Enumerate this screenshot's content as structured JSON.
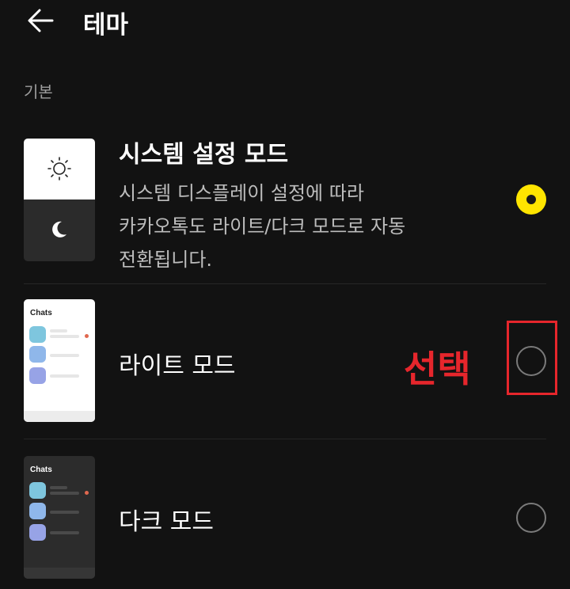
{
  "header": {
    "title": "테마",
    "back_icon": "arrow-left-icon"
  },
  "section": {
    "label": "기본"
  },
  "options": [
    {
      "id": "system",
      "title": "시스템 설정 모드",
      "description_lines": [
        "시스템 디스플레이 설정에 따라",
        "카카오톡도 라이트/다크 모드로 자동",
        "전환됩니다."
      ],
      "selected": true,
      "icons": [
        "sun-icon",
        "moon-icon"
      ]
    },
    {
      "id": "light",
      "title": "라이트 모드",
      "selected": false,
      "thumb_label": "Chats"
    },
    {
      "id": "dark",
      "title": "다크 모드",
      "selected": false,
      "thumb_label": "Chats"
    }
  ],
  "annotation": {
    "text": "선택"
  },
  "colors": {
    "background": "#121212",
    "accent_radio": "#ffe500",
    "annotation_red": "#e6262c",
    "secondary_text": "#bdbdbd"
  }
}
